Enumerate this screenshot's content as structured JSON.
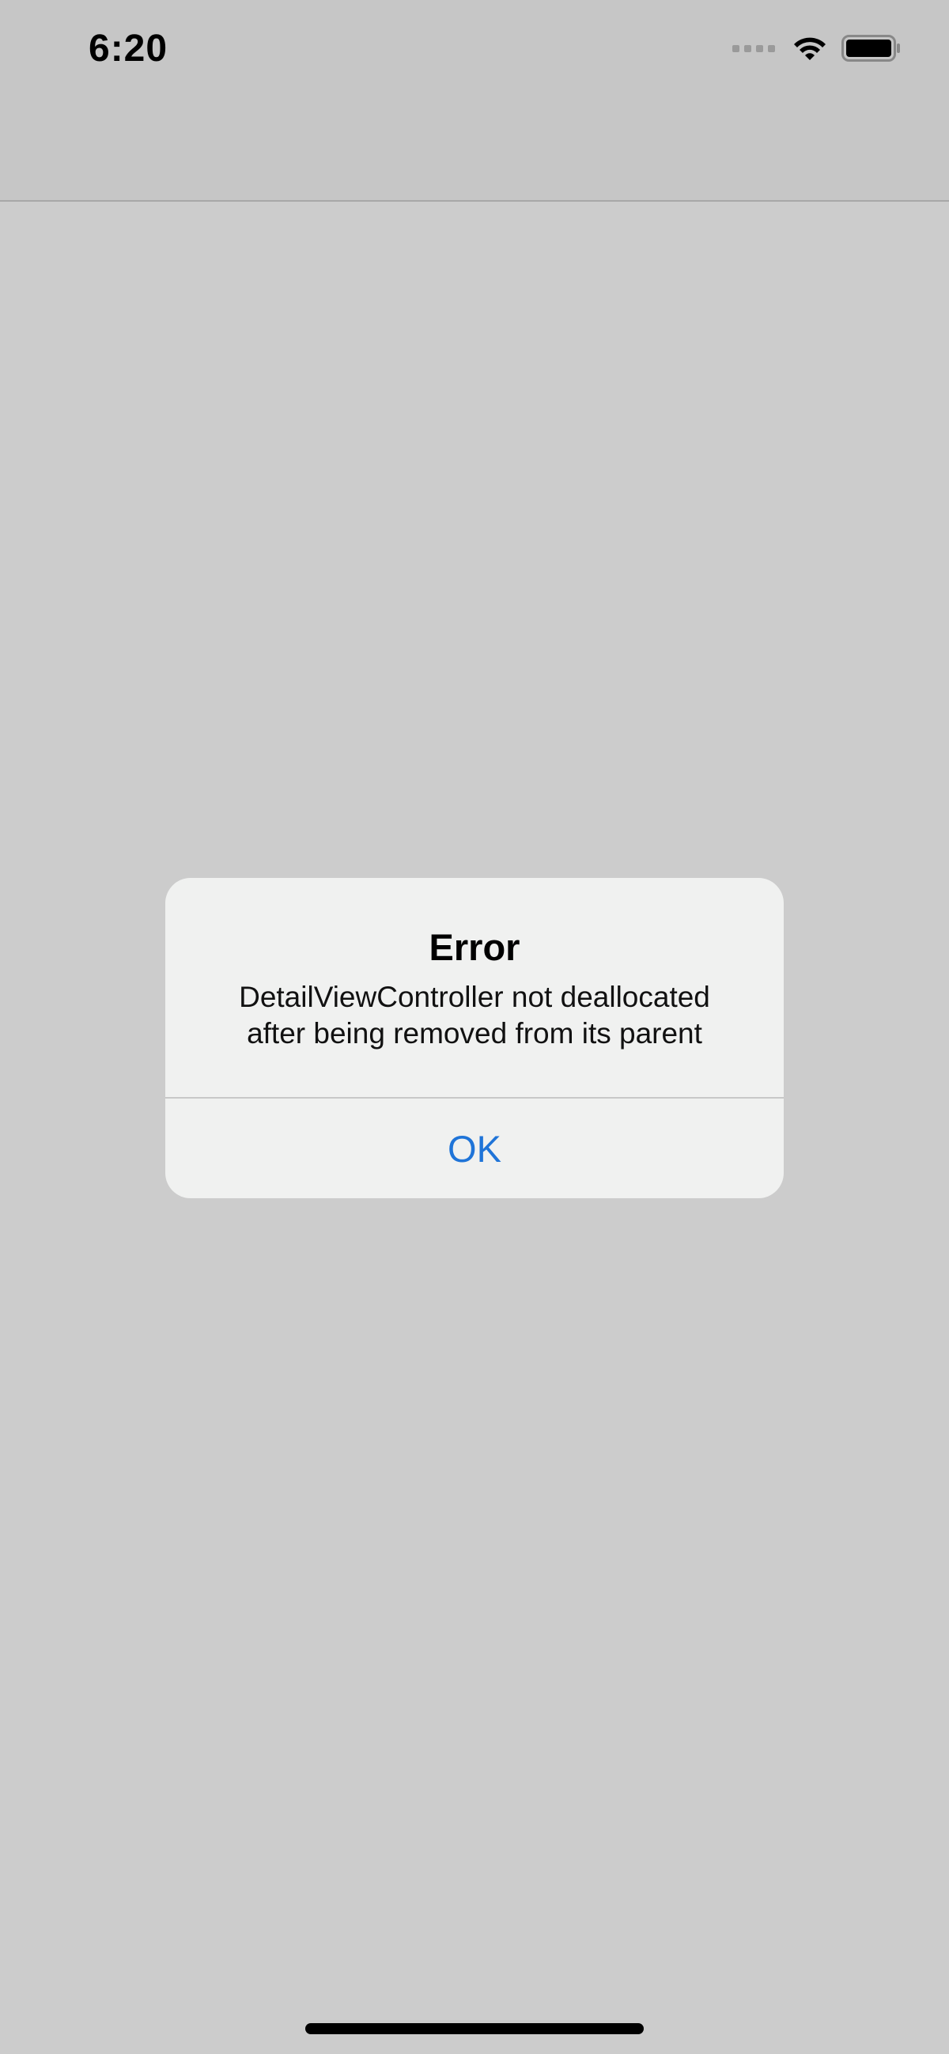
{
  "status_bar": {
    "time": "6:20",
    "icons": [
      "signal-icon",
      "wifi-icon",
      "battery-icon"
    ]
  },
  "alert": {
    "title": "Error",
    "message_line1": "DetailViewController not deallocated",
    "message_line2": "after being removed from its parent",
    "ok_label": "OK"
  },
  "colors": {
    "overlay_background": "#cccccc",
    "header_background": "#c6c6c6",
    "alert_background": "#f0f1f0",
    "accent": "#1f74d8"
  }
}
